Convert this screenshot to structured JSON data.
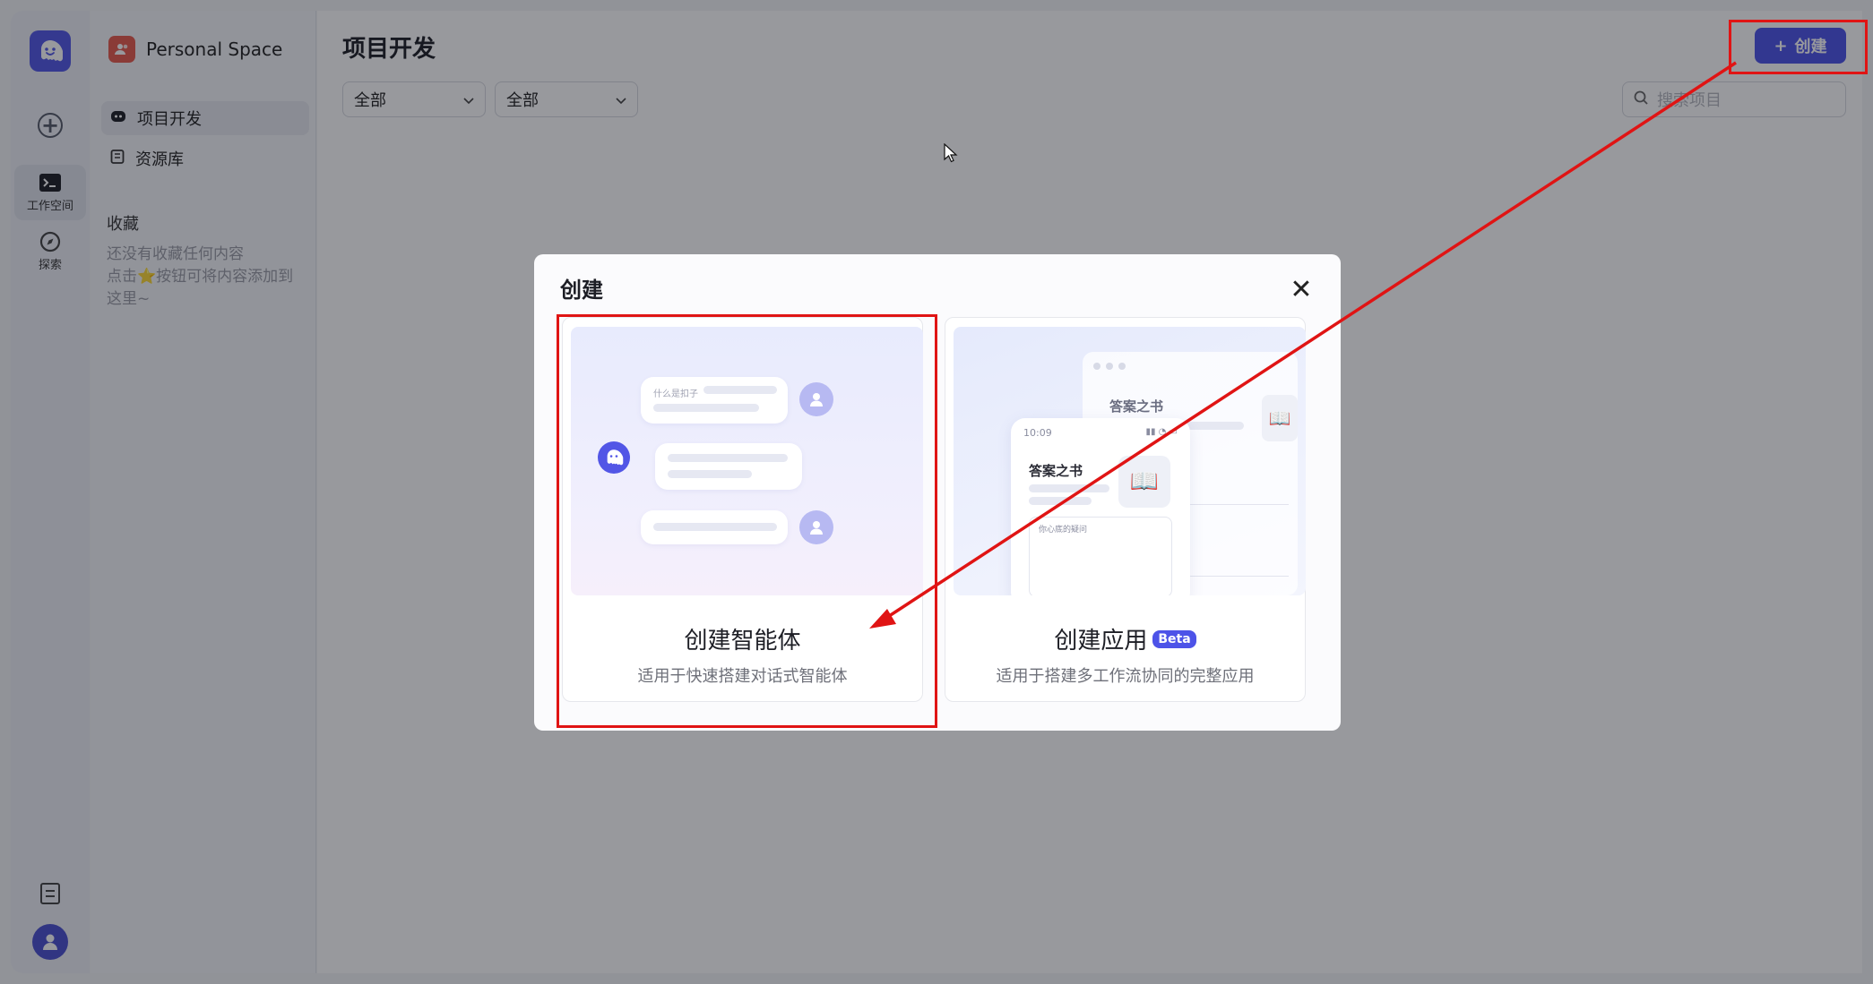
{
  "colors": {
    "accent": "#4d53e8",
    "annotation": "#e01414",
    "space_badge": "#e65a4d"
  },
  "rail": {
    "logo_icon": "coze-logo-icon",
    "add_icon": "plus-circle-icon",
    "items": [
      {
        "label": "工作空间",
        "icon": "terminal-icon",
        "active": true
      },
      {
        "label": "探索",
        "icon": "compass-icon",
        "active": false
      }
    ],
    "docs_icon": "document-icon",
    "avatar_icon": "user-avatar-icon"
  },
  "sidebar": {
    "space_name": "Personal Space",
    "nav": [
      {
        "label": "项目开发",
        "icon": "bot-icon",
        "active": true
      },
      {
        "label": "资源库",
        "icon": "library-icon",
        "active": false
      }
    ],
    "favorites_title": "收藏",
    "favorites_empty_line1": "还没有收藏任何内容",
    "favorites_empty_line2_pre": "点击",
    "favorites_empty_line2_post": "按钮可将内容添加到",
    "favorites_empty_line3": "这里~"
  },
  "main": {
    "title": "项目开发",
    "filter1": "全部",
    "filter2": "全部",
    "create_label": "创建",
    "search_placeholder": "搜索项目"
  },
  "modal": {
    "title": "创建",
    "cards": [
      {
        "title": "创建智能体",
        "subtitle": "适用于快速搭建对话式智能体",
        "illustration_text": "什么是扣子"
      },
      {
        "title": "创建应用",
        "badge": "Beta",
        "subtitle": "适用于搭建多工作流协同的完整应用",
        "window_app_name": "答案之书",
        "phone_time": "10:09",
        "phone_app_name": "答案之书",
        "phone_input_hint": "你心底的疑问"
      }
    ]
  }
}
